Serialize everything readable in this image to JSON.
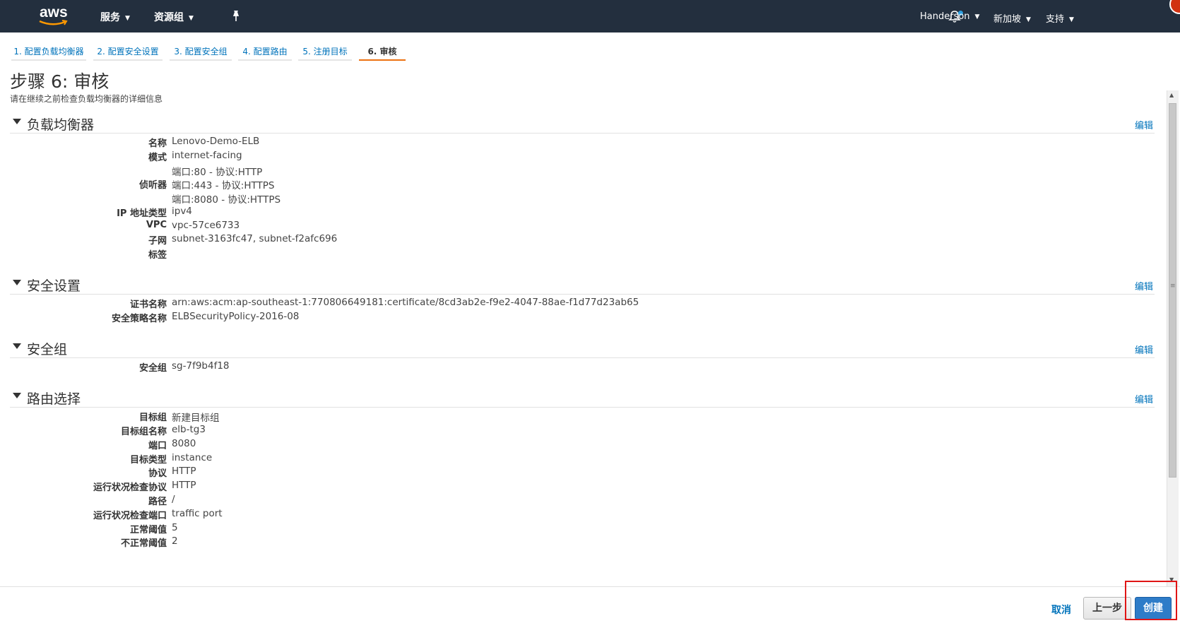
{
  "topnav": {
    "logo_text": "aws",
    "services_label": "服务",
    "resource_groups_label": "资源组",
    "user_label": "Handerson",
    "region_label": "新加坡",
    "support_label": "支持"
  },
  "wizard_tabs": [
    {
      "label": "1. 配置负载均衡器"
    },
    {
      "label": "2. 配置安全设置"
    },
    {
      "label": "3. 配置安全组"
    },
    {
      "label": "4. 配置路由"
    },
    {
      "label": "5. 注册目标"
    },
    {
      "label": "6. 审核"
    }
  ],
  "page": {
    "title": "步骤 6: 审核",
    "subtitle": "请在继续之前检查负载均衡器的详细信息"
  },
  "sections": {
    "edit_label": "编辑",
    "load_balancer": {
      "title": "负载均衡器",
      "rows": [
        {
          "k": "名称",
          "v": "Lenovo-Demo-ELB"
        },
        {
          "k": "模式",
          "v": "internet-facing"
        },
        {
          "k": "",
          "v": "端口:80 - 协议:HTTP"
        },
        {
          "k": "侦听器",
          "v": "端口:443 - 协议:HTTPS"
        },
        {
          "k": "",
          "v": "端口:8080 - 协议:HTTPS"
        },
        {
          "k": "IP 地址类型",
          "v": "ipv4"
        },
        {
          "k": "VPC",
          "v": "vpc-57ce6733"
        },
        {
          "k": "子网",
          "v": "subnet-3163fc47, subnet-f2afc696"
        },
        {
          "k": "标签",
          "v": ""
        }
      ]
    },
    "security_settings": {
      "title": "安全设置",
      "rows": [
        {
          "k": "证书名称",
          "v": "arn:aws:acm:ap-southeast-1:770806649181:certificate/8cd3ab2e-f9e2-4047-88ae-f1d77d23ab65"
        },
        {
          "k": "安全策略名称",
          "v": "ELBSecurityPolicy-2016-08"
        }
      ]
    },
    "security_groups": {
      "title": "安全组",
      "rows": [
        {
          "k": "安全组",
          "v": "sg-7f9b4f18"
        }
      ]
    },
    "routing": {
      "title": "路由选择",
      "rows": [
        {
          "k": "目标组",
          "v": "新建目标组"
        },
        {
          "k": "目标组名称",
          "v": "elb-tg3"
        },
        {
          "k": "端口",
          "v": "8080"
        },
        {
          "k": "目标类型",
          "v": "instance"
        },
        {
          "k": "协议",
          "v": "HTTP"
        },
        {
          "k": "运行状况检查协议",
          "v": "HTTP"
        },
        {
          "k": "路径",
          "v": "/"
        },
        {
          "k": "运行状况检查端口",
          "v": "traffic port"
        },
        {
          "k": "正常阈值",
          "v": "5"
        },
        {
          "k": "不正常阈值",
          "v": "2"
        }
      ]
    }
  },
  "footer": {
    "cancel_label": "取消",
    "previous_label": "上一步",
    "create_label": "创建"
  },
  "colors": {
    "nav_bg": "#232f3e",
    "link": "#0073bb",
    "active_tab_underline": "#ec7211",
    "primary_button": "#2e7cc8",
    "highlight": "#e01515"
  },
  "icons": {
    "pin": "pin-icon",
    "bell": "bell-icon",
    "caret": "caret-down-icon",
    "collapse": "triangle-down-icon"
  }
}
